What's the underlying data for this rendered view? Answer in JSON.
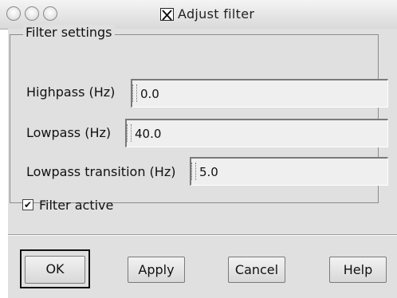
{
  "window": {
    "title": "Adjust filter"
  },
  "group": {
    "title": "Filter settings",
    "highpass": {
      "label": "Highpass (Hz)",
      "value": "0.0"
    },
    "lowpass": {
      "label": "Lowpass (Hz)",
      "value": "40.0"
    },
    "transition": {
      "label": "Lowpass transition (Hz)",
      "value": "5.0"
    },
    "active": {
      "label": "Filter active",
      "checked": true,
      "mark": "✔"
    }
  },
  "buttons": {
    "ok": "OK",
    "apply": "Apply",
    "cancel": "Cancel",
    "help": "Help"
  },
  "icons": {
    "window-controls": [
      "close-icon",
      "minimize-icon",
      "zoom-icon"
    ],
    "title-logo": "x11-logo-icon"
  }
}
